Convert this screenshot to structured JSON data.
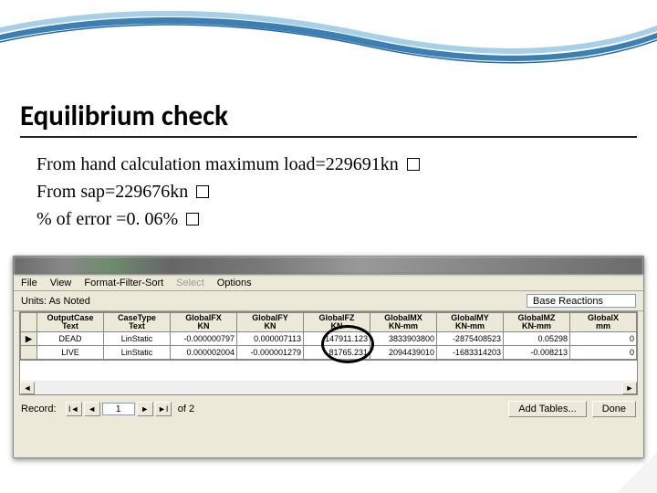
{
  "slide": {
    "title": "Equilibrium check",
    "lines": {
      "l1": "From hand calculation maximum load=229691kn",
      "l2": "From sap=229676kn",
      "l3": "% of error =0. 06%"
    }
  },
  "app": {
    "menu": {
      "file": "File",
      "view": "View",
      "ffs": "Format-Filter-Sort",
      "select": "Select",
      "options": "Options"
    },
    "units_label": "Units:  As Noted",
    "title_field": "Base Reactions",
    "columns": [
      {
        "h1": "OutputCase",
        "h2": "Text"
      },
      {
        "h1": "CaseType",
        "h2": "Text"
      },
      {
        "h1": "GlobalFX",
        "h2": "KN"
      },
      {
        "h1": "GlobalFY",
        "h2": "KN"
      },
      {
        "h1": "GlobalFZ",
        "h2": "KN"
      },
      {
        "h1": "GlobalMX",
        "h2": "KN-mm"
      },
      {
        "h1": "GlobalMY",
        "h2": "KN-mm"
      },
      {
        "h1": "GlobalMZ",
        "h2": "KN-mm"
      },
      {
        "h1": "GlobalX",
        "h2": "mm"
      }
    ],
    "rows": [
      {
        "marker": "▶",
        "case": "DEAD",
        "type": "LinStatic",
        "fx": "-0.000000797",
        "fy": "0.000007113",
        "fz": "147911.123",
        "mx": "3833903800",
        "my": "-2875408523",
        "mz": "0.05298",
        "x": "0"
      },
      {
        "marker": "",
        "case": "LIVE",
        "type": "LinStatic",
        "fx": "0.000002004",
        "fy": "-0.000001279",
        "fz": "81765.231",
        "mx": "2094439010",
        "my": "-1683314203",
        "mz": "-0.008213",
        "x": "0"
      }
    ],
    "footer": {
      "record_label": "Record:",
      "current": "1",
      "of_text": "of 2",
      "add_tables": "Add Tables...",
      "done": "Done"
    }
  }
}
